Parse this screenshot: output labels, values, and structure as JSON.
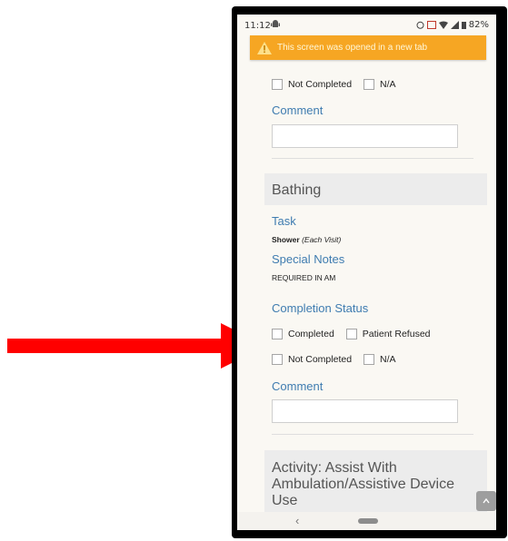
{
  "status_bar": {
    "time": "11:12",
    "battery": "82%"
  },
  "toast": {
    "message": "This screen was opened in a new tab"
  },
  "top_section": {
    "checkboxes": [
      "Not Completed",
      "N/A"
    ],
    "comment_label": "Comment"
  },
  "bathing": {
    "title": "Bathing",
    "task_label": "Task",
    "task_name": "Shower",
    "task_freq": "(Each Visit)",
    "notes_label": "Special Notes",
    "notes_value": "REQUIRED IN AM",
    "status_label": "Completion Status",
    "options": [
      "Completed",
      "Patient Refused",
      "Not Completed",
      "N/A"
    ],
    "comment_label": "Comment"
  },
  "next_section": {
    "title_lines": [
      "Activity: Assist With",
      "Ambulation/Assistive Device",
      "Use"
    ]
  },
  "colors": {
    "accent": "#3f7cb0",
    "toast": "#f6a623",
    "arrow": "#ff0000"
  }
}
